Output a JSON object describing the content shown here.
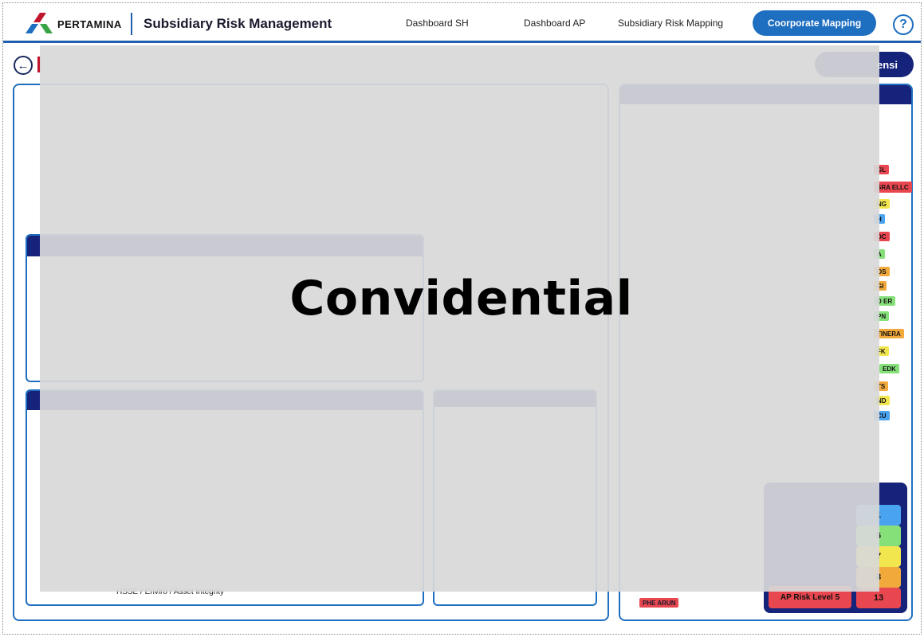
{
  "header": {
    "logo_text": "PERTAMINA",
    "app_title": "Subsidiary Risk Management",
    "nav": {
      "dashboard_sh": "Dashboard SH",
      "dashboard_ap": "Dashboard AP",
      "subsidiary_risk_mapping": "Subsidiary Risk Mapping"
    },
    "corporate_mapping_button": "Coorporate Mapping",
    "help_icon": "?"
  },
  "subbar": {
    "back_icon": "←",
    "kompetensi_button": "ensi"
  },
  "left_panel": {
    "hsse_label": "HSSE / Enviro / Asset Integrity"
  },
  "right_panel": {
    "tags": [
      {
        "label": "GL",
        "color": "red"
      },
      {
        "label": "SRA ELLC",
        "color": "red"
      },
      {
        "label": "NG",
        "color": "yellow"
      },
      {
        "label": "H",
        "color": "blue"
      },
      {
        "label": "DC",
        "color": "red"
      },
      {
        "label": "A",
        "color": "green"
      },
      {
        "label": "OS",
        "color": "orange"
      },
      {
        "label": "GI",
        "color": "orange"
      },
      {
        "label": "D ER",
        "color": "green"
      },
      {
        "label": "PN",
        "color": "green"
      },
      {
        "label": "TINERA",
        "color": "orange"
      },
      {
        "label": "FK",
        "color": "yellow"
      },
      {
        "label": "EDK",
        "color": "green"
      },
      {
        "label": "TS",
        "color": "orange"
      },
      {
        "label": "ND",
        "color": "yellow"
      },
      {
        "label": "CU",
        "color": "blue"
      }
    ],
    "phe_arun": "PHE ARUN",
    "legend": {
      "level5_label": "AP Risk Level 5",
      "counts": [
        {
          "value": "1",
          "color": "#4aa3f0"
        },
        {
          "value": "6",
          "color": "#86e07a"
        },
        {
          "value": "7",
          "color": "#f2e64e"
        },
        {
          "value": "8",
          "color": "#f2a93b"
        },
        {
          "value": "13",
          "color": "#e8474f"
        }
      ]
    }
  },
  "overlay": {
    "text": "Convidential"
  },
  "colors": {
    "primary_blue": "#1f6fc1",
    "navy": "#16237a",
    "accent_red": "#c0152b"
  }
}
